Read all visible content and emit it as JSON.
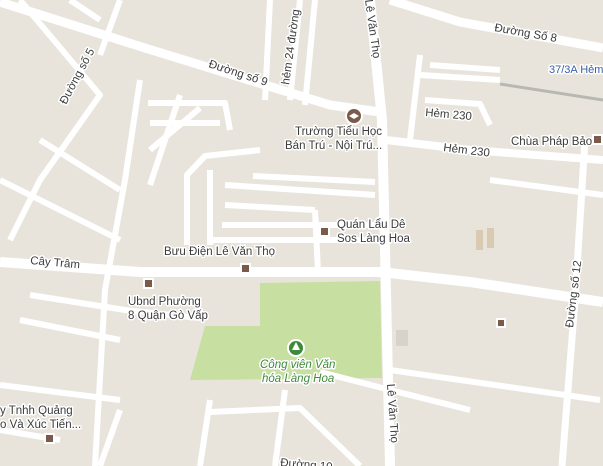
{
  "map": {
    "colors": {
      "land": "#e8e4dc",
      "road": "#ffffff",
      "park": "#c8dfa2",
      "poi_marker": "#7a5a4a",
      "park_label": "#3e8a3a",
      "label_text": "#3b3b3b",
      "transit_label": "#3a5fa5"
    },
    "streets": {
      "duong_so_8": "Đường Số 8",
      "duong_so_5": "Đường số 5",
      "duong_so_9": "Đường số 9",
      "hem_24": "hẻm 24 đường",
      "le_van_tho_top": "Lê Văn Thọ",
      "hem_230_a": "Hẻm 230",
      "hem_230_b": "Hẻm 230",
      "cay_tram": "Cây Trâm",
      "duong_so_12": "Đường số 12",
      "le_van_tho_bottom": "Lê Văn Thọ",
      "duong_bottom": "Đường 10"
    },
    "transit": {
      "label": "37/3A Hẻm"
    },
    "pois": {
      "truong": {
        "line1": "Trường Tiểu Học",
        "line2": "Bán Trú - Nội Trú...",
        "icon": "school-icon"
      },
      "chua": {
        "line1": "Chùa Pháp Bảo",
        "icon": "place-icon"
      },
      "quan_lau": {
        "line1": "Quán Lẩu Dê",
        "line2": "Sos Làng Hoa",
        "icon": "place-icon"
      },
      "buu_dien": {
        "line1": "Bưu Điện Lê Văn Thọ",
        "icon": "place-icon"
      },
      "ubnd": {
        "line1": "Ubnd Phường",
        "line2": "8 Quận Gò Vấp",
        "icon": "place-icon"
      },
      "cong_ty": {
        "line1": "y Tnhh Quảng",
        "line2": "o Và Xúc Tiến...",
        "icon": "place-icon"
      },
      "park": {
        "line1": "Công viên Văn",
        "line2": "hóa Làng Hoa",
        "icon": "tree-icon"
      }
    }
  }
}
